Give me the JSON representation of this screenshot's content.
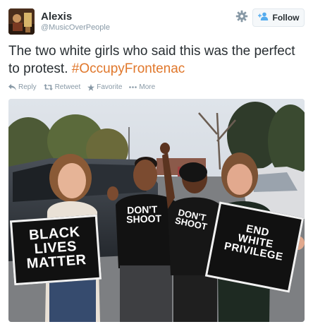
{
  "user": {
    "name": "Alexis",
    "handle": "@MusicOverPeople"
  },
  "follow_button": {
    "label": "Follow"
  },
  "tweet": {
    "text": "The two white girls who said this was the perfect to protest.",
    "hashtag": "#OccupyFrontenac"
  },
  "actions": {
    "reply": "Reply",
    "retweet": "Retweet",
    "favorite": "Favorite",
    "more": "More"
  },
  "photo": {
    "sign_left": [
      "BLACK",
      "LIVES",
      "MATTER"
    ],
    "sign_right": [
      "END",
      "WHITE",
      "PRIVILEGE"
    ],
    "shirt_1": [
      "DON'T",
      "SHOOT"
    ],
    "shirt_2": [
      "DON'T",
      "SHOOT"
    ]
  },
  "colors": {
    "hashtag": "#e0772b",
    "muted": "#8899a6",
    "text": "#292f33",
    "follow_icon": "#55acee"
  },
  "icons": {
    "gear": "gear-icon",
    "follow": "add-user-icon",
    "reply": "reply-icon",
    "retweet": "retweet-icon",
    "favorite": "star-icon",
    "more": "more-dots-icon"
  }
}
